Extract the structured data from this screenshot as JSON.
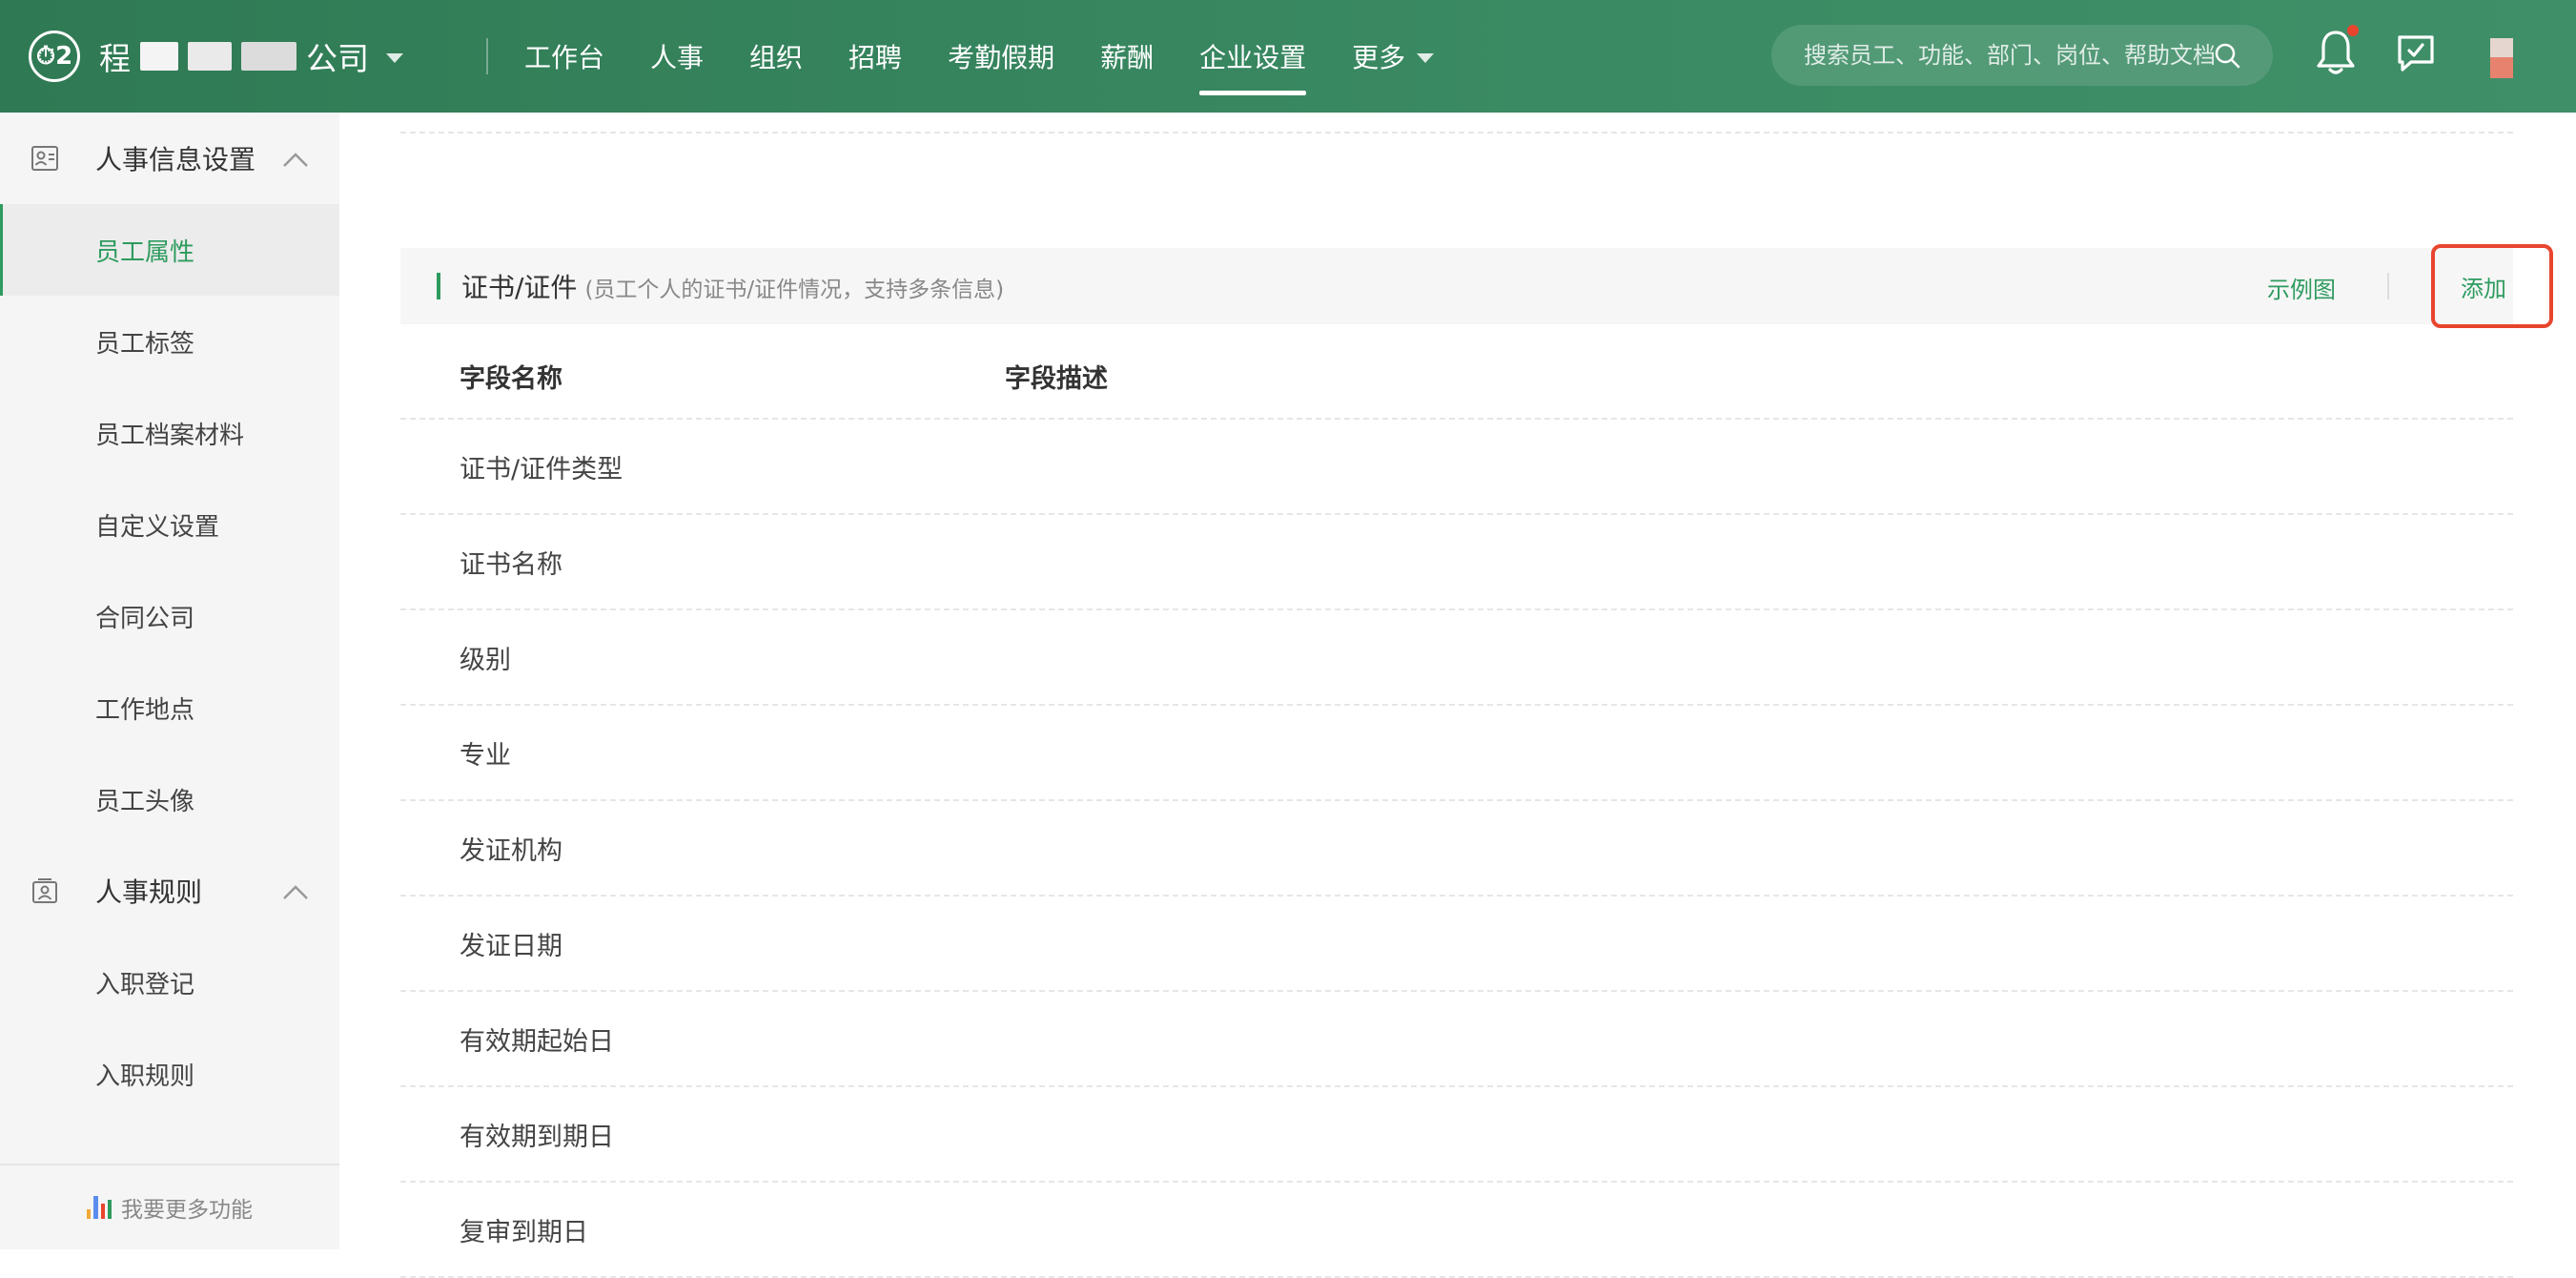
{
  "topbar": {
    "logo_text": "⏱2",
    "company_prefix": "程",
    "company_suffix": "公司",
    "nav": [
      {
        "label": "工作台"
      },
      {
        "label": "人事"
      },
      {
        "label": "组织"
      },
      {
        "label": "招聘"
      },
      {
        "label": "考勤假期"
      },
      {
        "label": "薪酬"
      },
      {
        "label": "企业设置",
        "active": true
      },
      {
        "label": "更多"
      }
    ],
    "search_placeholder": "搜索员工、功能、部门、岗位、帮助文档"
  },
  "sidebar": {
    "group1": {
      "label": "人事信息设置"
    },
    "group1_items": [
      "员工属性",
      "员工标签",
      "员工档案材料",
      "自定义设置",
      "合同公司",
      "工作地点",
      "员工头像"
    ],
    "group2": {
      "label": "人事规则"
    },
    "group2_items": [
      "入职登记",
      "入职规则"
    ],
    "footer": "我要更多功能"
  },
  "main": {
    "section": {
      "title": "证书/证件",
      "subtitle": "(员工个人的证书/证件情况，支持多条信息)",
      "example_link": "示例图",
      "add_button": "添加"
    },
    "table": {
      "headers": [
        "字段名称",
        "字段描述"
      ],
      "rows": [
        "证书/证件类型",
        "证书名称",
        "级别",
        "专业",
        "发证机构",
        "发证日期",
        "有效期起始日",
        "有效期到期日",
        "复审到期日"
      ]
    }
  },
  "colors": {
    "brand_green": "#2e9b5f",
    "topbar_green": "#3a8a63",
    "highlight_red": "#e8452e"
  }
}
